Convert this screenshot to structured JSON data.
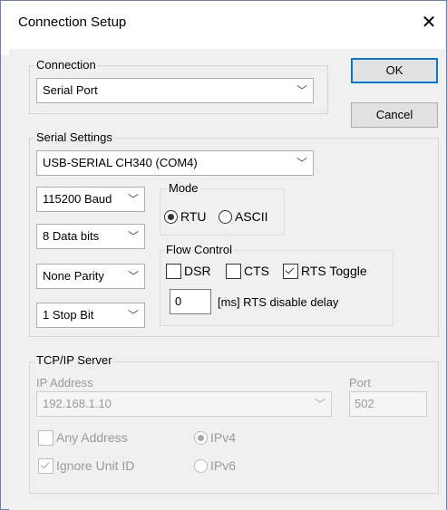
{
  "window": {
    "title": "Connection Setup",
    "close_glyph": "✕"
  },
  "connection": {
    "label": "Connection",
    "type_value": "Serial Port"
  },
  "buttons": {
    "ok": "OK",
    "cancel": "Cancel"
  },
  "serial": {
    "label": "Serial Settings",
    "port_value": "USB-SERIAL CH340 (COM4)",
    "baud_value": "115200 Baud",
    "data_bits_value": "8 Data bits",
    "parity_value": "None Parity",
    "stop_bits_value": "1 Stop Bit",
    "mode": {
      "label": "Mode",
      "rtu": "RTU",
      "ascii": "ASCII",
      "selected": "RTU"
    },
    "flow": {
      "label": "Flow Control",
      "dsr": "DSR",
      "cts": "CTS",
      "rts_toggle": "RTS Toggle",
      "dsr_checked": false,
      "cts_checked": false,
      "rts_toggle_checked": true,
      "rts_delay_value": "0",
      "rts_delay_label": "[ms] RTS disable delay"
    }
  },
  "tcp": {
    "label": "TCP/IP Server",
    "ip_label": "IP Address",
    "ip_value": "192.168.1.10",
    "port_label": "Port",
    "port_value": "502",
    "any_address": "Any Address",
    "ignore_unit_id": "Ignore Unit ID",
    "ipv4": "IPv4",
    "ipv6": "IPv6",
    "any_address_checked": false,
    "ignore_unit_id_checked": true,
    "ip_version_selected": "IPv4"
  },
  "icons": {
    "chevron": "﹀",
    "close": "close-icon"
  }
}
